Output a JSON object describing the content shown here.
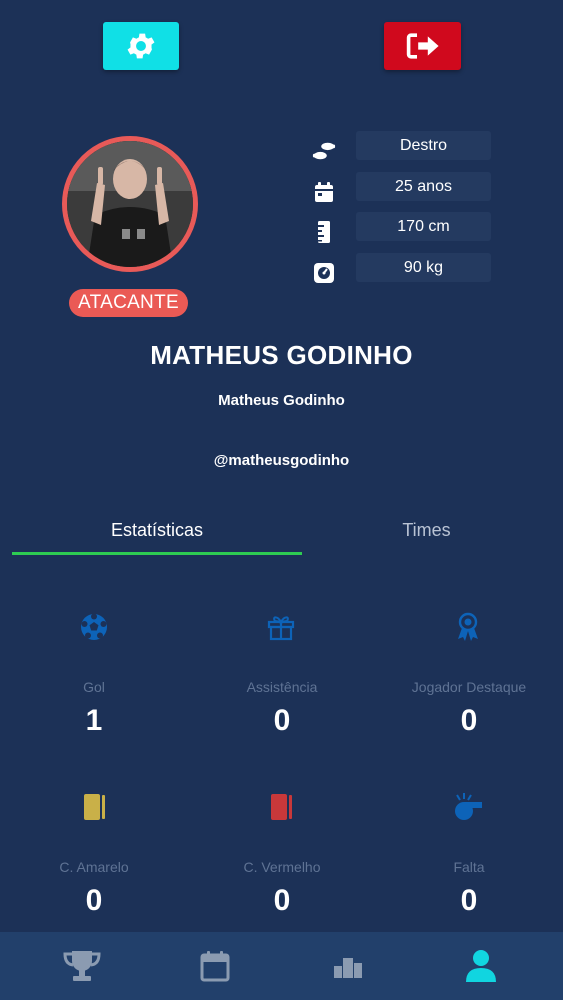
{
  "header": {
    "settings_icon": "gear-icon",
    "logout_icon": "sign-out-icon",
    "colors": {
      "settings": "#10e0e6",
      "logout": "#d0091d"
    }
  },
  "profile": {
    "position": "ATACANTE",
    "display_name": "MATHEUS GODINHO",
    "full_name": "Matheus Godinho",
    "handle": "@matheusgodinho",
    "info": [
      {
        "icon": "footprints-icon",
        "value": "Destro"
      },
      {
        "icon": "calendar-icon",
        "value": "25 anos"
      },
      {
        "icon": "ruler-icon",
        "value": "170 cm"
      },
      {
        "icon": "weight-scale-icon",
        "value": "90 kg"
      }
    ]
  },
  "tabs": [
    {
      "label": "Estatísticas",
      "active": true
    },
    {
      "label": "Times",
      "active": false
    }
  ],
  "stats": [
    {
      "icon": "soccer-ball-icon",
      "label": "Gol",
      "value": "1",
      "color": "#0d63b8"
    },
    {
      "icon": "gift-icon",
      "label": "Assistência",
      "value": "0",
      "color": "#0d63b8"
    },
    {
      "icon": "award-ribbon-icon",
      "label": "Jogador Destaque",
      "value": "0",
      "color": "#0d63b8"
    },
    {
      "icon": "yellow-card-icon",
      "label": "C. Amarelo",
      "value": "0",
      "color": "#c9b048"
    },
    {
      "icon": "red-card-icon",
      "label": "C. Vermelho",
      "value": "0",
      "color": "#c8383a"
    },
    {
      "icon": "whistle-icon",
      "label": "Falta",
      "value": "0",
      "color": "#0d63b8"
    }
  ],
  "bottom_nav": [
    {
      "icon": "trophy-icon",
      "active": false
    },
    {
      "icon": "calendar-icon",
      "active": false
    },
    {
      "icon": "podium-icon",
      "active": false
    },
    {
      "icon": "user-icon",
      "active": true
    }
  ]
}
